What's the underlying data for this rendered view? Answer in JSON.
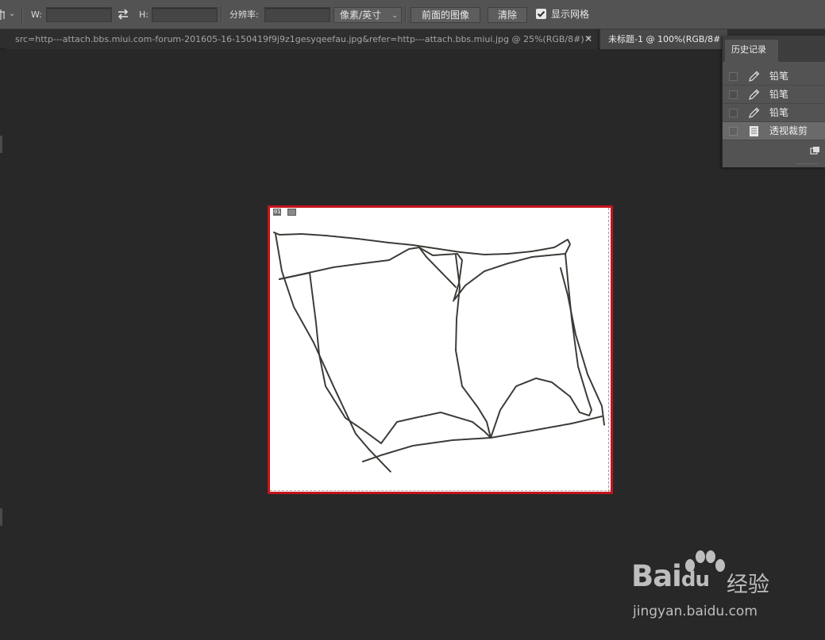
{
  "options_bar": {
    "width_label": "W:",
    "width_value": "",
    "height_label": "H:",
    "height_value": "",
    "resolution_label": "分辨率:",
    "resolution_value": "",
    "unit_selected": "像素/英寸",
    "front_image_button": "前面的图像",
    "clear_button": "清除",
    "show_grid_label": "显示网格",
    "show_grid_checked": true
  },
  "tabs": [
    {
      "label": "src=http---attach.bbs.miui.com-forum-201605-16-150419f9j9z1gesyqeefau.jpg&refer=http---attach.bbs.miui.jpg @ 25%(RGB/8#) *",
      "active": false
    },
    {
      "label": "未标题-1 @ 100%(RGB/8#",
      "active": true
    }
  ],
  "canvas": {
    "slice_badge": "01",
    "frame_color": "#c4151c",
    "background": "#ffffff"
  },
  "history_panel": {
    "title": "历史记录",
    "items": [
      {
        "label": "铅笔",
        "icon": "pencil-icon",
        "active": false
      },
      {
        "label": "铅笔",
        "icon": "pencil-icon",
        "active": false
      },
      {
        "label": "铅笔",
        "icon": "pencil-icon",
        "active": false
      },
      {
        "label": "透视裁剪",
        "icon": "document-icon",
        "active": true
      }
    ]
  },
  "watermark": {
    "brand": "Bai",
    "brand_suffix": "du",
    "product": "经验",
    "url": "jingyan.baidu.com"
  }
}
